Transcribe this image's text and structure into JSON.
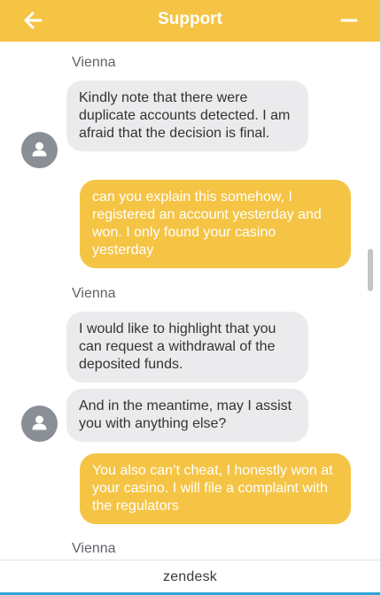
{
  "header": {
    "title": "Support",
    "back_icon": "arrow-left-icon",
    "minimize_icon": "minus-icon"
  },
  "messages": [
    {
      "type": "sender",
      "text": "Vienna"
    },
    {
      "type": "agent",
      "text": "Kindly note that there were duplicate accounts detected. I am afraid that the decision is final."
    },
    {
      "type": "user",
      "text": "can you explain this somehow, I registered an account yesterday and won. I only found your casino yesterday"
    },
    {
      "type": "sender",
      "text": "Vienna"
    },
    {
      "type": "agent",
      "text": "I would like to highlight that you can request a withdrawal of the deposited funds."
    },
    {
      "type": "agent",
      "text": "And in the meantime, may I assist you with anything else?"
    },
    {
      "type": "user",
      "text": "You also can’t cheat, I honestly won at your casino. I will file a complaint with the regulators"
    },
    {
      "type": "sender",
      "text": "Vienna"
    }
  ],
  "footer": {
    "brand": "zendesk"
  },
  "colors": {
    "accent": "#f5c445",
    "agent_bubble": "#ebebed",
    "footer_line": "#2ea4d9"
  }
}
